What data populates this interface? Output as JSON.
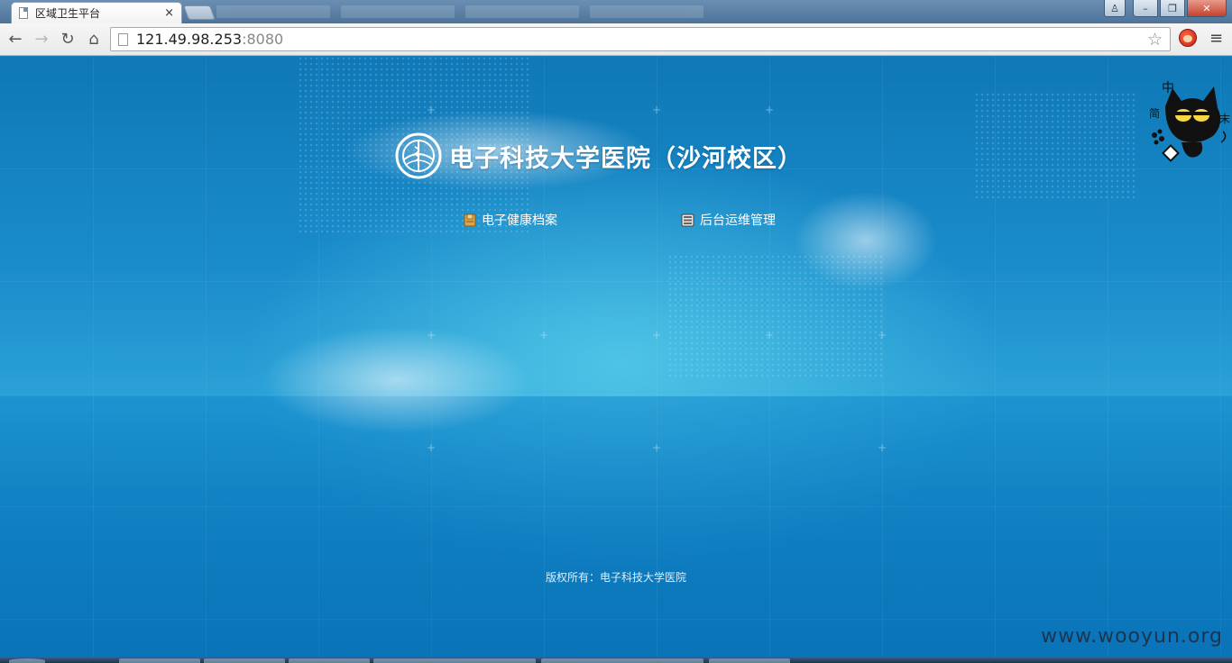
{
  "browser": {
    "tab_title": "区域卫生平台",
    "tab_close": "×",
    "url_host": "121.49.98.253",
    "url_port": ":8080",
    "back": "←",
    "forward": "→",
    "reload": "↻",
    "home": "⌂",
    "star": "☆",
    "menu": "≡",
    "win_user": "♙",
    "win_min": "–",
    "win_max": "❐",
    "win_close": "✕"
  },
  "page": {
    "title": "电子科技大学医院（沙河校区）",
    "links": [
      {
        "label": "电子健康档案",
        "icon": "folder-icon"
      },
      {
        "label": "后台运维管理",
        "icon": "server-icon"
      }
    ],
    "copyright": "版权所有：电子科技大学医院"
  },
  "overlay": {
    "watermark": "www.wooyun.org",
    "mascot_text": [
      "中",
      "简",
      "末"
    ]
  },
  "colors": {
    "page_bg": "#1a8ccb",
    "glow": "#52c8e8",
    "title": "#ffffff",
    "chrome_toolbar": "#f2f2f2"
  }
}
